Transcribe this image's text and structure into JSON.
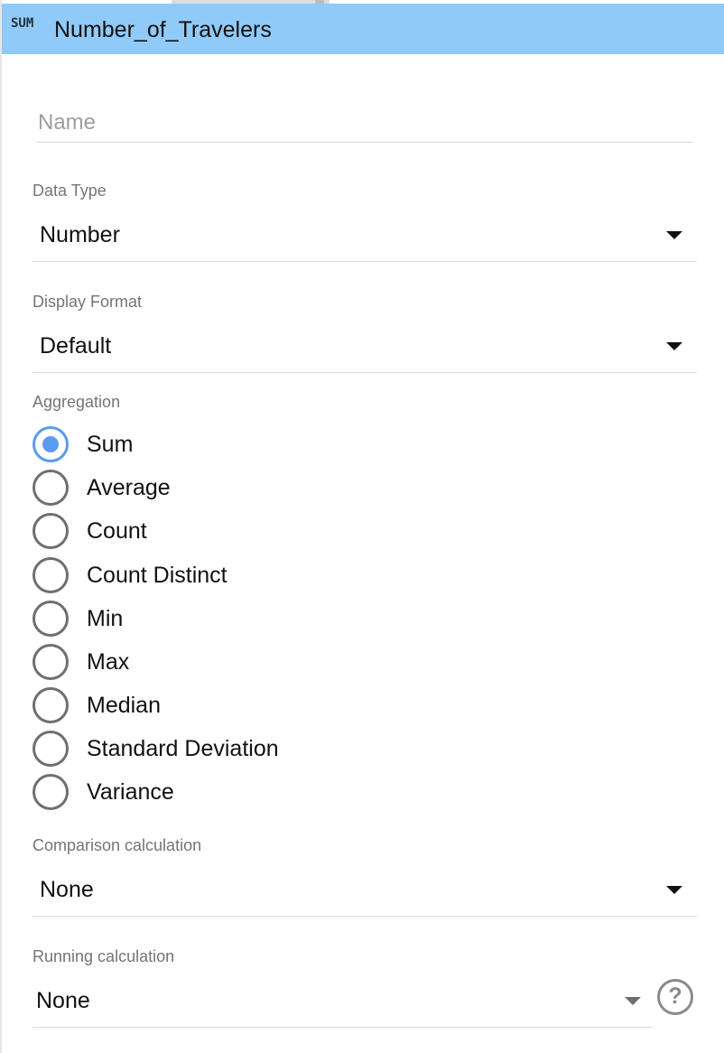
{
  "header": {
    "aggregation_tag": "SUM",
    "field_name": "Number_of_Travelers"
  },
  "name_field": {
    "placeholder": "Name",
    "value": ""
  },
  "data_type": {
    "label": "Data Type",
    "value": "Number"
  },
  "display_format": {
    "label": "Display Format",
    "value": "Default"
  },
  "aggregation": {
    "label": "Aggregation",
    "selected": "Sum",
    "options": [
      "Sum",
      "Average",
      "Count",
      "Count Distinct",
      "Min",
      "Max",
      "Median",
      "Standard Deviation",
      "Variance"
    ]
  },
  "comparison_calculation": {
    "label": "Comparison calculation",
    "value": "None"
  },
  "running_calculation": {
    "label": "Running calculation",
    "value": "None",
    "help_icon_glyph": "?"
  },
  "colors": {
    "header_bg": "#90caf9",
    "radio_selected": "#5b9bf0",
    "radio_unselected": "#6f6f6f",
    "label_text": "#757575"
  }
}
